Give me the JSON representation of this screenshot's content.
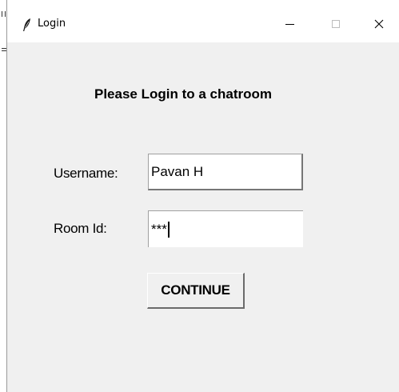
{
  "window": {
    "title": "Login",
    "minimize_icon": "minimize-icon",
    "maximize_icon": "maximize-icon",
    "close_icon": "close-icon",
    "close_glyph": "✕"
  },
  "form": {
    "heading": "Please Login to a chatroom",
    "username_label": "Username:",
    "username_value": "Pavan H",
    "room_label": "Room Id:",
    "room_value_masked": "***",
    "continue_label": "CONTINUE"
  },
  "colors": {
    "window_bg": "#f0f0f0",
    "titlebar_bg": "#ffffff",
    "entry_bg": "#ffffff"
  }
}
